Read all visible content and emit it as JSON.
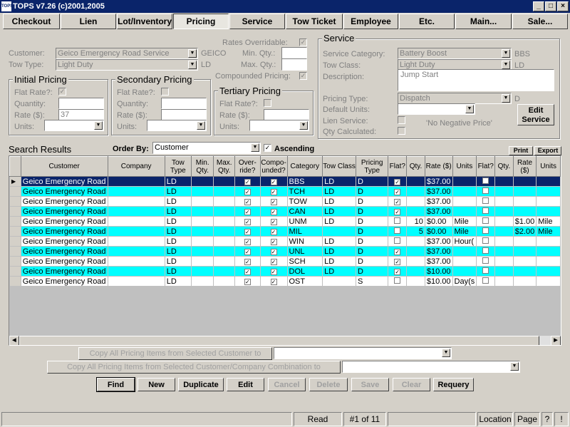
{
  "window": {
    "title": "TOPS v7.26 (c)2001,2005",
    "icon_text": "TOPS",
    "min": "_",
    "max": "□",
    "close": "×"
  },
  "tabs": [
    "Checkout",
    "Lien",
    "Lot/Inventory",
    "Pricing",
    "Service",
    "Tow Ticket",
    "Employee",
    "Etc.",
    "Main...",
    "Sale..."
  ],
  "form": {
    "rates_overridable_label": "Rates Overridable:",
    "customer_label": "Customer:",
    "customer_value": "Geico Emergency Road Service",
    "customer_code": "GEICO",
    "tow_type_label": "Tow Type:",
    "tow_type_value": "Light Duty",
    "tow_type_code": "LD",
    "min_qty_label": "Min. Qty.:",
    "max_qty_label": "Max. Qty.:",
    "compounded_pricing_label": "Compounded Pricing:"
  },
  "initial_pricing": {
    "title": "Initial Pricing",
    "flat_rate_label": "Flat Rate?:",
    "quantity_label": "Quantity:",
    "rate_label": "Rate ($):",
    "rate_value": "37",
    "units_label": "Units:"
  },
  "secondary_pricing": {
    "title": "Secondary Pricing",
    "flat_rate_label": "Flat Rate?:",
    "quantity_label": "Quantity:",
    "rate_label": "Rate ($):",
    "units_label": "Units:"
  },
  "tertiary_pricing": {
    "title": "Tertiary Pricing",
    "flat_rate_label": "Flat Rate?:",
    "quantity_label": "Quantity:",
    "rate_label": "Rate ($):",
    "units_label": "Units:"
  },
  "service": {
    "title": "Service",
    "category_label": "Service Category:",
    "category_value": "Battery Boost",
    "category_code": "BBS",
    "tow_class_label": "Tow Class:",
    "tow_class_value": "Light Duty",
    "tow_class_code": "LD",
    "description_label": "Description:",
    "description_value": "Jump Start",
    "pricing_type_label": "Pricing Type:",
    "pricing_type_value": "Dispatch",
    "pricing_type_code": "D",
    "default_units_label": "Default Units:",
    "lien_service_label": "Lien Service:",
    "qty_calculated_label": "Qty Calculated:",
    "no_negative_price": "'No Negative Price'",
    "edit_service_button": "Edit Service"
  },
  "search": {
    "title": "Search Results",
    "order_by_label": "Order By:",
    "order_by_value": "Customer",
    "ascending_label": "Ascending",
    "print_button": "Print",
    "export_button": "Export"
  },
  "grid": {
    "columns": [
      "Customer",
      "Company",
      "Tow Type",
      "Min. Qty.",
      "Max. Qty.",
      "Over-ride?",
      "Compo-unded?",
      "Category",
      "Tow Class",
      "Pricing Type",
      "Flat?",
      "Qty.",
      "Rate ($)",
      "Units",
      "Flat?",
      "Qty.",
      "Rate ($)",
      "Units"
    ],
    "rows": [
      {
        "customer": "Geico Emergency Road",
        "tow_type": "LD",
        "override": true,
        "compounded": true,
        "category": "BBS",
        "tow_class": "LD",
        "pricing_type": "D",
        "flat": true,
        "qty": "",
        "rate": "$37.00",
        "units": "",
        "qty2": "",
        "rate2": "",
        "units2": ""
      },
      {
        "customer": "Geico Emergency Road",
        "tow_type": "LD",
        "override": true,
        "compounded": true,
        "category": "TCH",
        "tow_class": "LD",
        "pricing_type": "D",
        "flat": true,
        "qty": "",
        "rate": "$37.00",
        "units": "",
        "qty2": "",
        "rate2": "",
        "units2": ""
      },
      {
        "customer": "Geico Emergency Road",
        "tow_type": "LD",
        "override": true,
        "compounded": true,
        "category": "TOW",
        "tow_class": "LD",
        "pricing_type": "D",
        "flat": true,
        "qty": "",
        "rate": "$37.00",
        "units": "",
        "qty2": "",
        "rate2": "",
        "units2": ""
      },
      {
        "customer": "Geico Emergency Road",
        "tow_type": "LD",
        "override": true,
        "compounded": true,
        "category": "CAN",
        "tow_class": "LD",
        "pricing_type": "D",
        "flat": true,
        "qty": "",
        "rate": "$37.00",
        "units": "",
        "qty2": "",
        "rate2": "",
        "units2": ""
      },
      {
        "customer": "Geico Emergency Road",
        "tow_type": "LD",
        "override": true,
        "compounded": true,
        "category": "UNM",
        "tow_class": "LD",
        "pricing_type": "D",
        "flat": false,
        "qty": "10",
        "rate": "$0.00",
        "units": "Mile",
        "qty2": "",
        "rate2": "$1.00",
        "units2": "Mile"
      },
      {
        "customer": "Geico Emergency Road",
        "tow_type": "LD",
        "override": true,
        "compounded": true,
        "category": "MIL",
        "tow_class": "",
        "pricing_type": "D",
        "flat": false,
        "qty": "5",
        "rate": "$0.00",
        "units": "Mile",
        "qty2": "",
        "rate2": "$2.00",
        "units2": "Mile"
      },
      {
        "customer": "Geico Emergency Road",
        "tow_type": "LD",
        "override": true,
        "compounded": true,
        "category": "WIN",
        "tow_class": "LD",
        "pricing_type": "D",
        "flat": false,
        "qty": "",
        "rate": "$37.00",
        "units": "Hour(",
        "qty2": "",
        "rate2": "",
        "units2": ""
      },
      {
        "customer": "Geico Emergency Road",
        "tow_type": "LD",
        "override": true,
        "compounded": true,
        "category": "UNL",
        "tow_class": "LD",
        "pricing_type": "D",
        "flat": true,
        "qty": "",
        "rate": "$37.00",
        "units": "",
        "qty2": "",
        "rate2": "",
        "units2": ""
      },
      {
        "customer": "Geico Emergency Road",
        "tow_type": "LD",
        "override": true,
        "compounded": true,
        "category": "SCH",
        "tow_class": "LD",
        "pricing_type": "D",
        "flat": true,
        "qty": "",
        "rate": "$37.00",
        "units": "",
        "qty2": "",
        "rate2": "",
        "units2": ""
      },
      {
        "customer": "Geico Emergency Road",
        "tow_type": "LD",
        "override": true,
        "compounded": true,
        "category": "DOL",
        "tow_class": "LD",
        "pricing_type": "D",
        "flat": true,
        "qty": "",
        "rate": "$10.00",
        "units": "",
        "qty2": "",
        "rate2": "",
        "units2": ""
      },
      {
        "customer": "Geico Emergency Road",
        "tow_type": "LD",
        "override": true,
        "compounded": true,
        "category": "OST",
        "tow_class": "",
        "pricing_type": "S",
        "flat": false,
        "qty": "",
        "rate": "$10.00",
        "units": "Day(s",
        "qty2": "",
        "rate2": "",
        "units2": ""
      }
    ]
  },
  "copy": {
    "customer_button": "Copy All Pricing Items from Selected Customer to",
    "company_button": "Copy All Pricing Items from Selected Customer/Company Combination to"
  },
  "actions": [
    "Find",
    "New",
    "Duplicate",
    "Edit",
    "Cancel",
    "Delete",
    "Save",
    "Clear",
    "Requery"
  ],
  "status": {
    "mode": "Read",
    "record": "#1 of 11",
    "location": "Location",
    "page": "Page",
    "help": "?",
    "extra": "!"
  }
}
